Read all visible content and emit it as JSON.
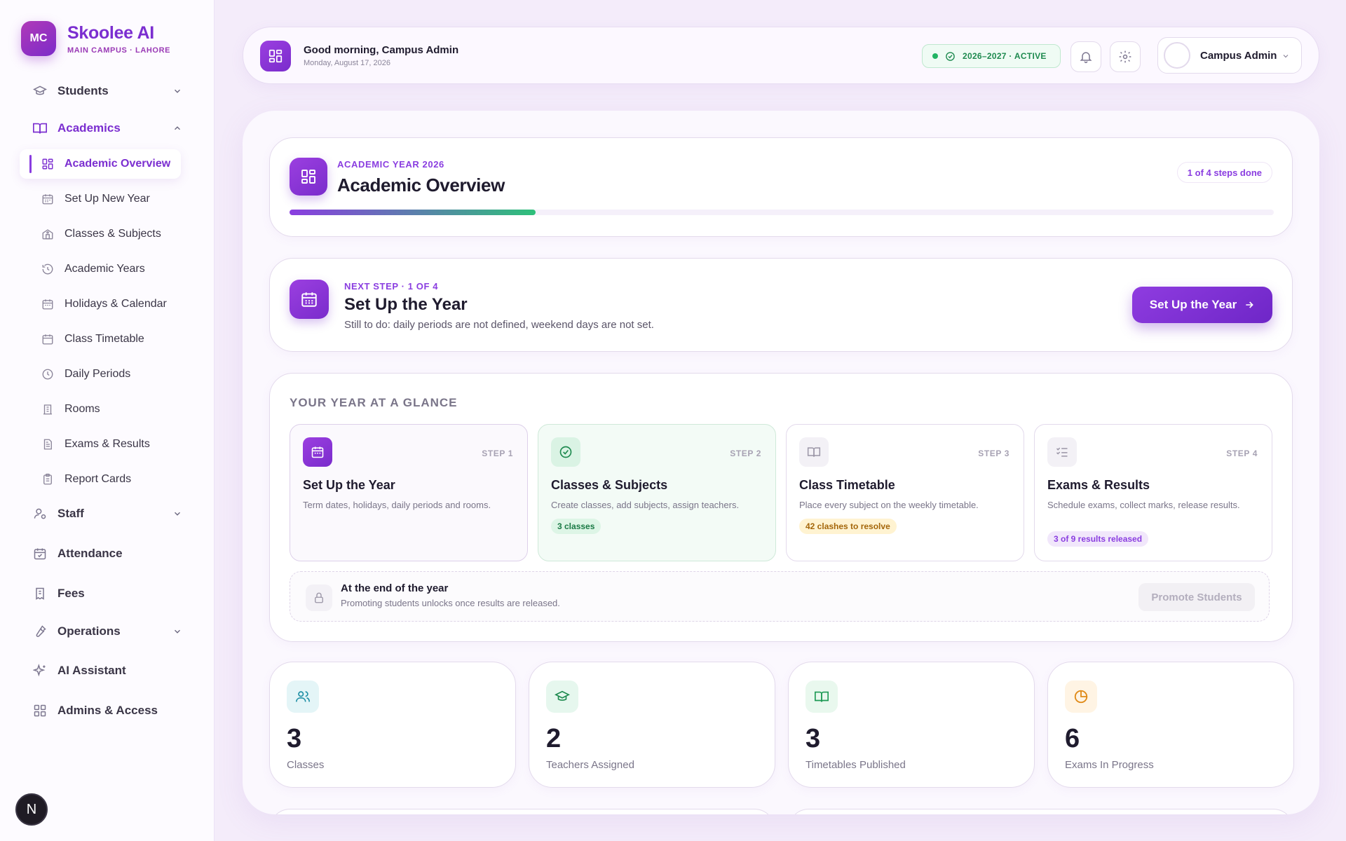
{
  "brand": {
    "initials": "MC",
    "name": "Skoolee AI",
    "campus": "MAIN CAMPUS · LAHORE"
  },
  "nav": {
    "students": "Students",
    "academics": "Academics",
    "academics_sub": [
      {
        "label": "Academic Overview",
        "icon": "grid-icon"
      },
      {
        "label": "Set Up New Year",
        "icon": "calendar-icon"
      },
      {
        "label": "Classes & Subjects",
        "icon": "school-icon"
      },
      {
        "label": "Academic Years",
        "icon": "history-icon"
      },
      {
        "label": "Holidays & Calendar",
        "icon": "calendar-icon"
      },
      {
        "label": "Class Timetable",
        "icon": "calendar-icon"
      },
      {
        "label": "Daily Periods",
        "icon": "clock-icon"
      },
      {
        "label": "Rooms",
        "icon": "building-icon"
      },
      {
        "label": "Exams & Results",
        "icon": "document-icon"
      },
      {
        "label": "Report Cards",
        "icon": "clipboard-icon"
      }
    ],
    "staff": "Staff",
    "attendance": "Attendance",
    "fees": "Fees",
    "operations": "Operations",
    "ai_assistant": "AI Assistant",
    "admins": "Admins & Access"
  },
  "dev_badge": "N",
  "topbar": {
    "greeting": "Good morning, Campus Admin",
    "date": "Monday, August 17, 2026",
    "year_status": "2026–2027 · ACTIVE",
    "user_name": "Campus Admin"
  },
  "colors": {
    "accent": "#7b2ed0",
    "success": "#21b463",
    "warning": "#e08a17"
  },
  "hero": {
    "eyebrow": "ACADEMIC YEAR 2026",
    "title": "Academic Overview",
    "steps_done": "1 of 4 steps done",
    "progress": 0.25
  },
  "next_step": {
    "eyebrow": "NEXT STEP · 1 OF 4",
    "title": "Set Up the Year",
    "desc": "Still to do: daily periods are not defined, weekend days are not set.",
    "cta": "Set Up the Year"
  },
  "glance": {
    "title": "YOUR YEAR AT A GLANCE",
    "steps": [
      {
        "step": "STEP 1",
        "title": "Set Up the Year",
        "desc": "Term dates, holidays, daily periods and rooms.",
        "tag": ""
      },
      {
        "step": "STEP 2",
        "title": "Classes & Subjects",
        "desc": "Create classes, add subjects, assign teachers.",
        "tag": "3 classes"
      },
      {
        "step": "STEP 3",
        "title": "Class Timetable",
        "desc": "Place every subject on the weekly timetable.",
        "tag": "42 clashes to resolve"
      },
      {
        "step": "STEP 4",
        "title": "Exams & Results",
        "desc": "Schedule exams, collect marks, release results.",
        "tag": "3 of 9 results released"
      }
    ],
    "end_title": "At the end of the year",
    "end_desc": "Promoting students unlocks once results are released.",
    "promote": "Promote Students"
  },
  "stats": [
    {
      "value": "3",
      "label": "Classes"
    },
    {
      "value": "2",
      "label": "Teachers Assigned"
    },
    {
      "value": "3",
      "label": "Timetables Published"
    },
    {
      "value": "6",
      "label": "Exams In Progress"
    }
  ]
}
